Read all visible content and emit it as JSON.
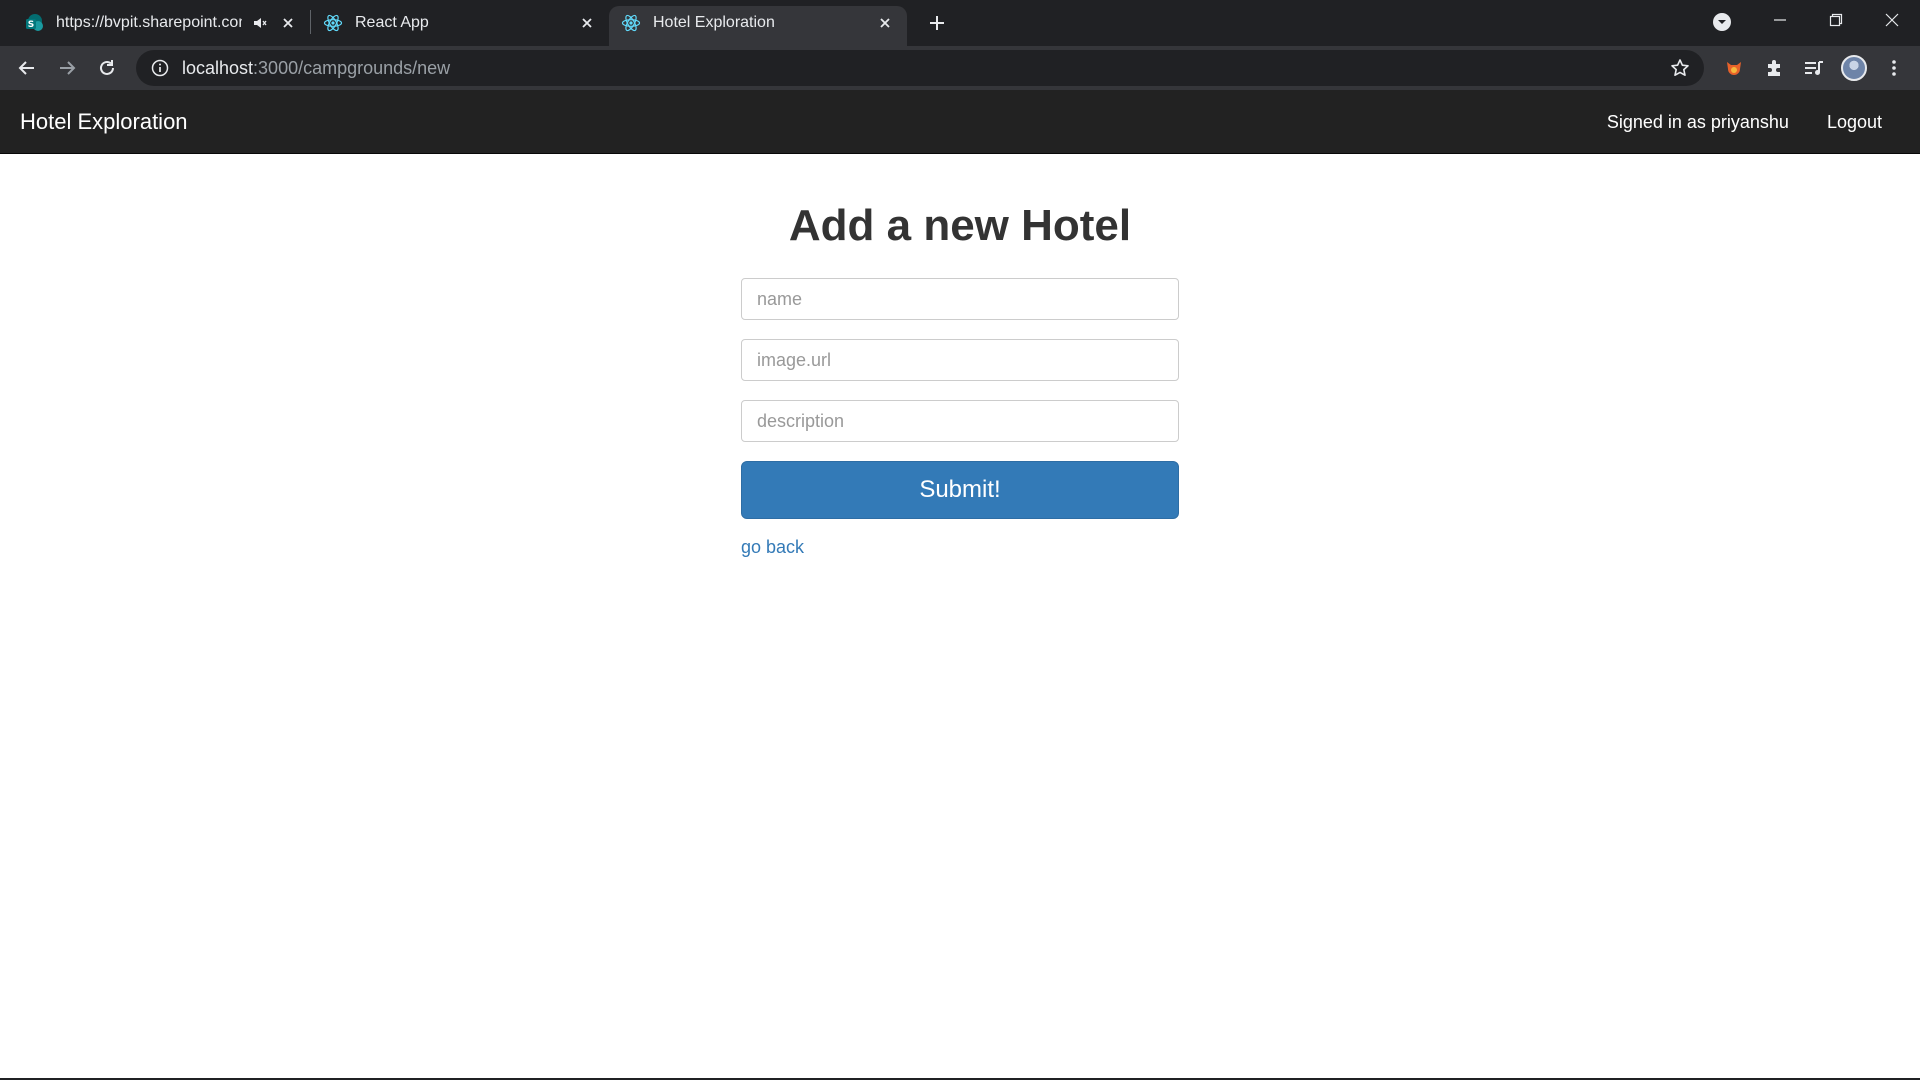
{
  "browser": {
    "tabs": [
      {
        "title": "https://bvpit.sharepoint.com/",
        "favicon": "sharepoint-icon",
        "muted_icon": "speaker-mute-icon",
        "active": false
      },
      {
        "title": "React App",
        "favicon": "react-icon",
        "active": false
      },
      {
        "title": "Hotel Exploration",
        "favicon": "react-icon",
        "active": true
      }
    ],
    "address_host": "localhost",
    "address_path": ":3000/campgrounds/new"
  },
  "navbar": {
    "brand": "Hotel Exploration",
    "signed_in": "Signed in as priyanshu",
    "logout": "Logout"
  },
  "form": {
    "heading": "Add a new Hotel",
    "name_placeholder": "name",
    "image_placeholder": "image.url",
    "description_placeholder": "description",
    "submit_label": "Submit!",
    "back_link": "go back"
  },
  "colors": {
    "navbar_bg": "#222222",
    "primary": "#337ab7",
    "chrome_dark": "#202124",
    "chrome_toolbar": "#35363a"
  }
}
